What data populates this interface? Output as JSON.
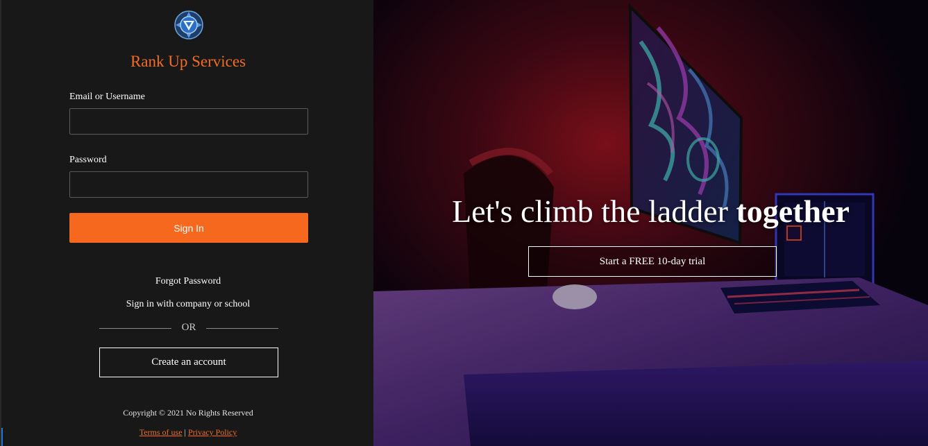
{
  "brand": {
    "name": "Rank Up Services",
    "logo_icon": "shield-emblem-icon",
    "accent_color": "#f26c22"
  },
  "login_form": {
    "email_label": "Email or Username",
    "email_value": "",
    "password_label": "Password",
    "password_value": "",
    "sign_in_label": "Sign In",
    "forgot_password": "Forgot Password",
    "company_sign_in": "Sign in with company or school",
    "or_text": "OR",
    "create_account": "Create an account"
  },
  "footer": {
    "copyright": "Copyright © 2021 No Rights Reserved",
    "terms": "Terms of use",
    "separator": "|",
    "privacy": "Privacy Policy"
  },
  "hero": {
    "headline_regular": "Let's climb the ladder ",
    "headline_bold": "together",
    "cta_label": "Start a FREE 10-day trial",
    "background": "gaming-setup-photo"
  }
}
